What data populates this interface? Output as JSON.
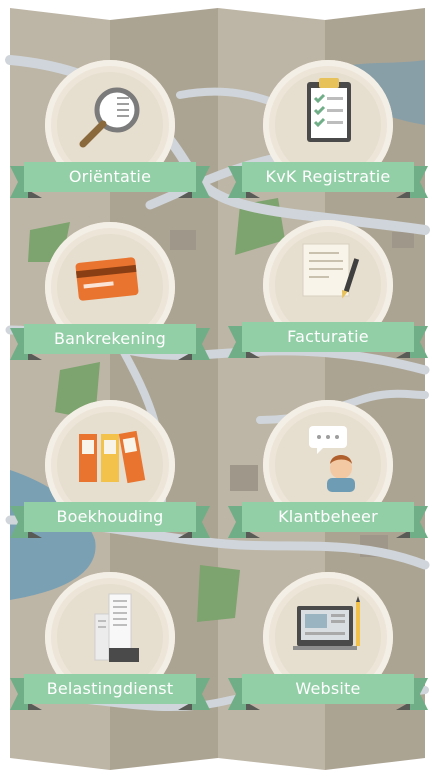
{
  "menu": {
    "items": [
      {
        "label": "Oriëntatie",
        "icon": "magnifier-icon"
      },
      {
        "label": "KvK Registratie",
        "icon": "clipboard-checklist-icon"
      },
      {
        "label": "Bankrekening",
        "icon": "bank-card-icon"
      },
      {
        "label": "Facturatie",
        "icon": "invoice-pen-icon"
      },
      {
        "label": "Boekhouding",
        "icon": "binders-icon"
      },
      {
        "label": "Klantbeheer",
        "icon": "customer-chat-icon"
      },
      {
        "label": "Belastingdienst",
        "icon": "tax-office-building-icon"
      },
      {
        "label": "Website",
        "icon": "computer-monitor-icon"
      }
    ]
  },
  "colors": {
    "map_light": "#bdb5a5",
    "map_dark": "#aca493",
    "road": "#cfd5da",
    "park": "#7da36e",
    "water": "#6f9cb5",
    "ribbon": "#92cfa6",
    "ribbon_fold": "#6fae86",
    "ribbon_tail": "#585b56",
    "badge": "#ece5d8"
  }
}
